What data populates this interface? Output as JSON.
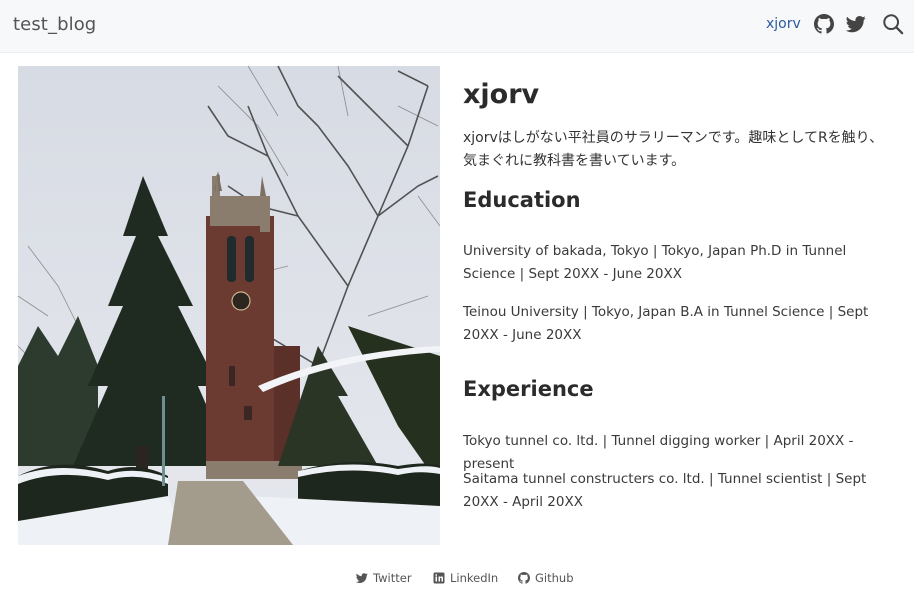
{
  "navbar": {
    "brand": "test_blog",
    "author_link": "xjorv",
    "icons": [
      "github-icon",
      "twitter-icon",
      "search-icon"
    ]
  },
  "about": {
    "name": "xjorv",
    "bio": "xjorvはしがない平社員のサラリーマンです。趣味としてRを触り、気まぐれに教科書を書いています。",
    "education": {
      "heading": "Education",
      "entries": [
        "University of bakada, Tokyo | Tokyo, Japan Ph.D in Tunnel Science | Sept 20XX - June 20XX",
        "Teinou University | Tokyo, Japan B.A in Tunnel Science | Sept 20XX - June 20XX"
      ]
    },
    "experience": {
      "heading": "Experience",
      "entries": [
        "Tokyo tunnel co. ltd. | Tunnel digging worker | April 20XX - present",
        "Saitama tunnel constructers co. ltd. | Tunnel scientist | Sept 20XX - April 20XX"
      ]
    }
  },
  "footer": {
    "twitter": "Twitter",
    "linkedin": "LinkedIn",
    "github": "Github"
  },
  "colors": {
    "navbar_bg": "#f7f8f9",
    "link": "#2c5aa0",
    "text": "#2f2f2f"
  }
}
